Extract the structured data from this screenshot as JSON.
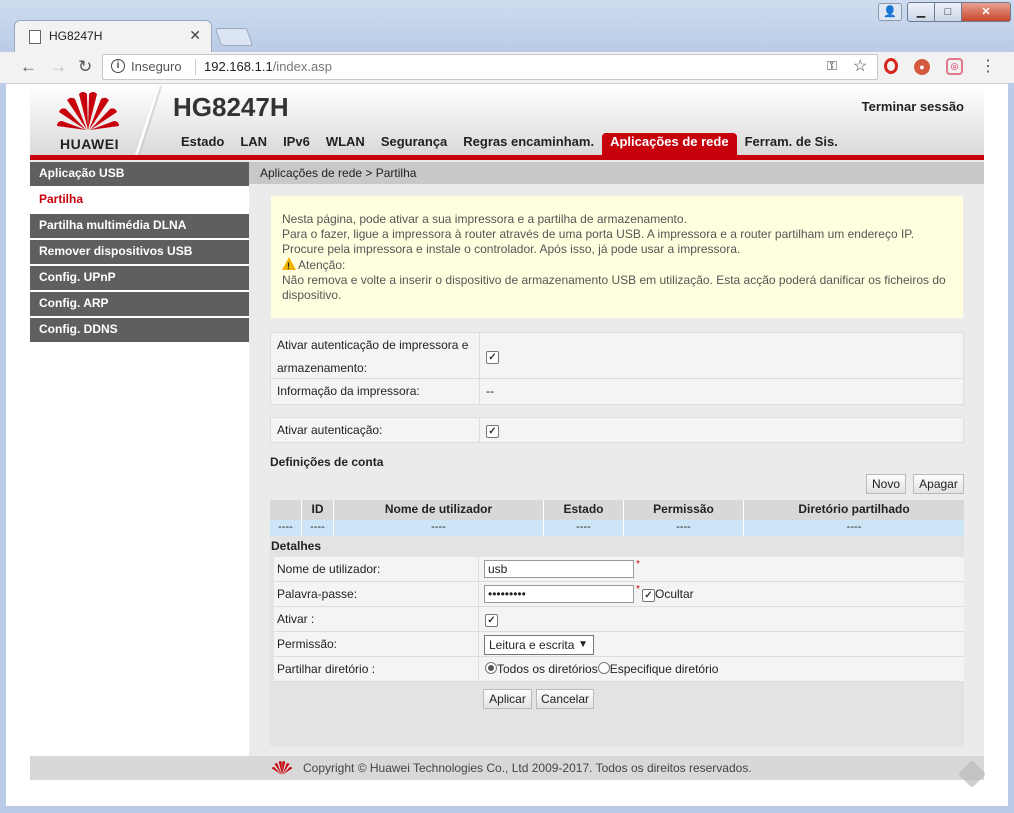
{
  "browser": {
    "tab_title": "HG8247H",
    "insecure_label": "Inseguro",
    "url_host": "192.168.1.1",
    "url_path": "/index.asp"
  },
  "header": {
    "brand": "HUAWEI",
    "model": "HG8247H",
    "logout": "Terminar sessão",
    "nav": [
      {
        "label": "Estado"
      },
      {
        "label": "LAN"
      },
      {
        "label": "IPv6"
      },
      {
        "label": "WLAN"
      },
      {
        "label": "Segurança"
      },
      {
        "label": "Regras encaminham."
      },
      {
        "label": "Aplicações de rede"
      },
      {
        "label": "Ferram. de Sis."
      }
    ]
  },
  "sidebar": {
    "items": [
      {
        "label": "Aplicação USB"
      },
      {
        "label": "Partilha"
      },
      {
        "label": "Partilha multimédia DLNA"
      },
      {
        "label": "Remover dispositivos USB"
      },
      {
        "label": "Config. UPnP"
      },
      {
        "label": "Config. ARP"
      },
      {
        "label": "Config. DDNS"
      }
    ]
  },
  "breadcrumb": "Aplicações de rede > Partilha",
  "notice": {
    "line1": "Nesta página, pode ativar a sua impressora e a partilha de armazenamento.",
    "line2": "Para o fazer, ligue a impressora à router através de uma porta USB. A impressora e a router partilham um endereço IP.",
    "line3": "Procure pela impressora e instale o controlador. Após isso, já pode usar a impressora.",
    "attention": "Atenção:",
    "line4": "Não remova e volte a inserir o dispositivo de armazenamento USB em utilização. Esta acção poderá danificar os ficheiros do dispositivo."
  },
  "form": {
    "printer_auth_label": "Ativar autenticação de impressora e armazenamento:",
    "printer_info_label": "Informação da impressora:",
    "printer_info_value": "--",
    "auth_label": "Ativar autenticação:"
  },
  "accounts": {
    "title": "Definições de conta",
    "new_button": "Novo",
    "delete_button": "Apagar",
    "columns": [
      "ID",
      "Nome de utilizador",
      "Estado",
      "Permissão",
      "Diretório partilhado"
    ],
    "row": [
      "----",
      "----",
      "----",
      "----",
      "----",
      "----"
    ]
  },
  "details": {
    "title": "Detalhes",
    "username_label": "Nome de utilizador:",
    "username_value": "usb",
    "password_label": "Palavra-passe:",
    "password_value": "•••••••••",
    "hide_label": "Ocultar",
    "enable_label": "Ativar :",
    "permission_label": "Permissão:",
    "permission_value": "Leitura e escrita",
    "share_dir_label": "Partilhar diretório :",
    "share_all": "Todos os diretórios",
    "share_specific": "Especifique diretório",
    "required_mark": "*",
    "apply_button": "Aplicar",
    "cancel_button": "Cancelar"
  },
  "footer": {
    "copyright": "Copyright © Huawei Technologies Co., Ltd 2009-2017. Todos os direitos reservados."
  },
  "colors": {
    "brand_red": "#c7000b",
    "sidebar_gray": "#5f5f5f",
    "notice_bg": "#ffffdf",
    "grid_row_blue": "#cde6f7"
  }
}
